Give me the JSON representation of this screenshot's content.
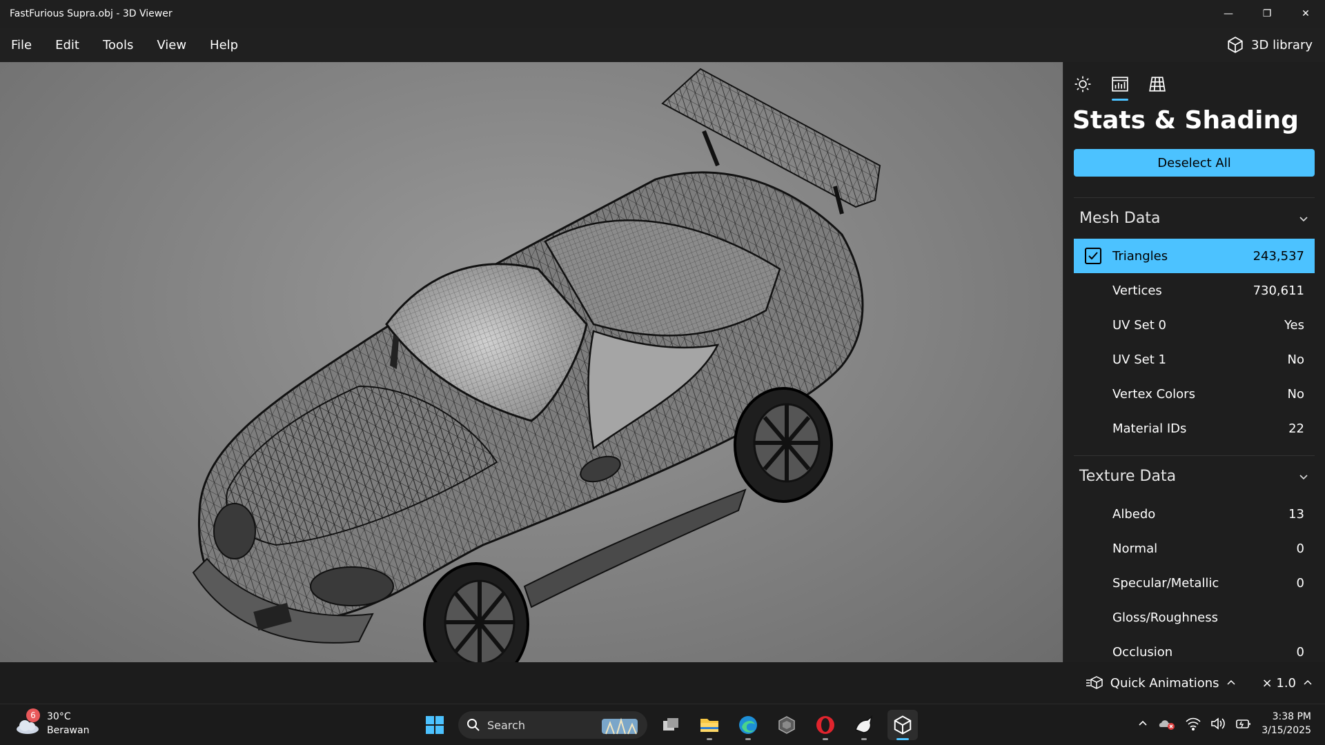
{
  "window": {
    "title": "FastFurious Supra.obj - 3D Viewer",
    "controls": {
      "minimize": "—",
      "restore": "❐",
      "close": "✕"
    }
  },
  "menu": {
    "items": [
      "File",
      "Edit",
      "Tools",
      "View",
      "Help"
    ]
  },
  "library": {
    "label": "3D library",
    "icon": "cube-icon"
  },
  "panel": {
    "tabs": [
      {
        "icon": "sun-icon",
        "active": false
      },
      {
        "icon": "stats-icon",
        "active": true
      },
      {
        "icon": "grid-icon",
        "active": false
      }
    ],
    "title": "Stats & Shading",
    "deselect_label": "Deselect All",
    "mesh": {
      "heading": "Mesh Data",
      "rows": [
        {
          "label": "Triangles",
          "value": "243,537",
          "checked": true
        },
        {
          "label": "Vertices",
          "value": "730,611"
        },
        {
          "label": "UV Set 0",
          "value": "Yes"
        },
        {
          "label": "UV Set 1",
          "value": "No"
        },
        {
          "label": "Vertex Colors",
          "value": "No"
        },
        {
          "label": "Material IDs",
          "value": "22"
        }
      ]
    },
    "texture": {
      "heading": "Texture Data",
      "rows": [
        {
          "label": "Albedo",
          "value": "13"
        },
        {
          "label": "Normal",
          "value": "0"
        },
        {
          "label": "Specular/Metallic",
          "value": "0"
        },
        {
          "label": "Gloss/Roughness",
          "value": ""
        },
        {
          "label": "Occlusion",
          "value": "0"
        }
      ]
    }
  },
  "statusbar": {
    "quick_animations": "Quick Animations",
    "speed": "× 1.0"
  },
  "taskbar": {
    "weather": {
      "badge": "6",
      "temp": "30°C",
      "condition": "Berawan"
    },
    "search_label": "Search",
    "clock": {
      "time": "3:38 PM",
      "date": "3/15/2025"
    }
  },
  "colors": {
    "accent": "#4cc2ff",
    "viewport_bg": "#858585",
    "panel_bg": "#1e1e1e"
  }
}
